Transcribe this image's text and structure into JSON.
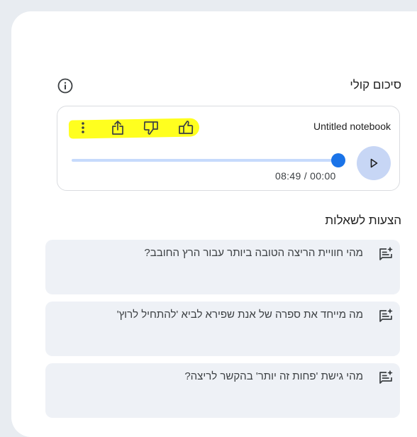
{
  "audio_overview": {
    "title": "סיכום קולי",
    "notebook_title": "Untitled notebook",
    "time": "08:49 / 00:00",
    "progress": 1.0
  },
  "suggestions": {
    "title": "הצעות לשאלות",
    "items": [
      "מהי חוויית הריצה הטובה ביותר עבור הרץ החובב?",
      "מה מייחד את ספרה של אנת שפירא לביא 'להתחיל לרוץ'",
      "מהי גישת 'פחות זה יותר' בהקשר לריצה?"
    ]
  },
  "colors": {
    "accent": "#1a73e8",
    "play_bg": "#c7d6f5",
    "highlight": "#ffff1f",
    "suggestion_bg": "#eef1f6"
  },
  "icons": [
    "info-icon",
    "more-vert-icon",
    "share-icon",
    "thumb-down-icon",
    "thumb-up-icon",
    "play-icon",
    "suggestion-icon"
  ]
}
